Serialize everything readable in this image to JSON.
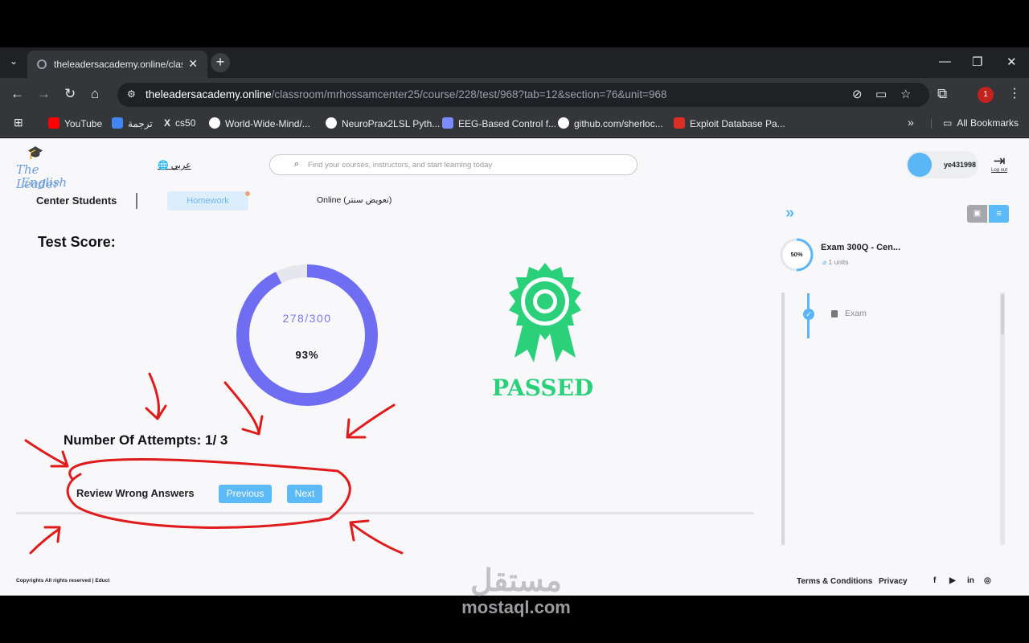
{
  "browser": {
    "tab_title": "theleadersacademy.online/classroom",
    "url_host": "theleadersacademy.online",
    "url_path": "/classroom/mrhossamcenter25/course/228/test/968?tab=12&section=76&unit=968",
    "profile_badge": "1",
    "bookmarks": [
      {
        "label": "YouTube",
        "color": "#ff0000"
      },
      {
        "label": "ترجمة",
        "color": "#4285f4"
      },
      {
        "label": "cs50",
        "color": "#000000"
      },
      {
        "label": "World-Wide-Mind/...",
        "color": "#ffffff"
      },
      {
        "label": "NeuroPrax2LSL Pyth...",
        "color": "#ffffff"
      },
      {
        "label": "EEG-Based Control f...",
        "color": "#7c8cff"
      },
      {
        "label": "github.com/sherloc...",
        "color": "#ffffff"
      },
      {
        "label": "Exploit Database Pa...",
        "color": "#d93025"
      }
    ],
    "all_bookmarks": "All Bookmarks"
  },
  "header": {
    "logo_line1": "The Leader",
    "logo_line2": "English",
    "language": "عربي",
    "search_placeholder": "Find your courses, instructors, and start learning today",
    "username": "ye431998",
    "logout": "Log out"
  },
  "subnav": {
    "title": "Center Students",
    "homework": "Homework",
    "online": "Online (تعويض سنتر)"
  },
  "result": {
    "heading": "Test Score:",
    "score": "278/300",
    "percent": "93%",
    "score_fraction": 0.9267,
    "status": "PASSED",
    "attempts": "Number Of Attempts: 1/ 3",
    "review": "Review Wrong Answers",
    "previous": "Previous",
    "next": "Next"
  },
  "sidebar": {
    "progress": "50%",
    "progress_fraction": 0.5,
    "course_title": "Exam 300Q - Cen...",
    "units": "1 units",
    "item": "Exam"
  },
  "footer": {
    "copyright": "Copyrights All rights reserved | Educt",
    "terms": "Terms & Conditions",
    "privacy": "Privacy"
  },
  "watermark": {
    "arabic": "مستقل",
    "latin": "mostaql.com"
  },
  "colors": {
    "accent_blue": "#5bbaf7",
    "ring_purple": "#6f6ef2",
    "passed_green": "#2bd17a",
    "annotation_red": "#e01b1b"
  }
}
